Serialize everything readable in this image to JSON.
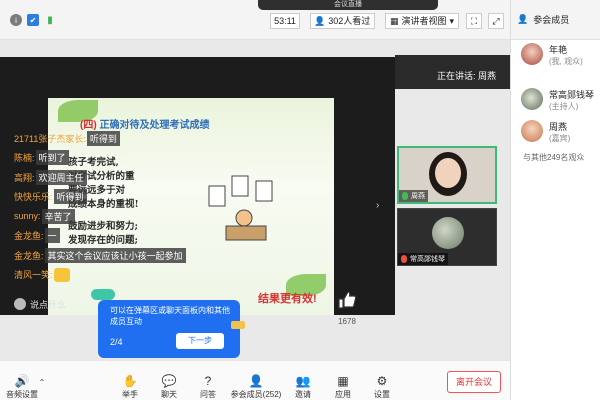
{
  "meeting": {
    "title_partial": "会议直播",
    "timer": "53:11",
    "viewers": "302人看过",
    "view_mode": "演讲者视图"
  },
  "speaking_now": "正在讲话: 周燕",
  "slide": {
    "heading_prefix": "(四)",
    "heading": "正确对待及处理考试成绩",
    "lines": [
      "孩子考完试,",
      "对考试分析的重",
      "要远远多于对",
      "成绩本身的重视!",
      "",
      "鼓励进步和努力;",
      "发现存在的问题;"
    ],
    "banner": "结果更有效!"
  },
  "chat": [
    {
      "name": "21711张子杰家长:",
      "msg": "听得到"
    },
    {
      "name": "陈楠:",
      "msg": "听到了"
    },
    {
      "name": "高翔:",
      "msg": "欢迎周主任"
    },
    {
      "name": "快快乐乐:",
      "msg": "听得到"
    },
    {
      "name": "sunny:",
      "msg": "辛苦了"
    },
    {
      "name": "金龙鱼:",
      "msg": "一"
    },
    {
      "name": "金龙鱼:",
      "msg": "其实这个会议应该让小孩一起参加"
    },
    {
      "name": "清风一笑:",
      "msg": ""
    }
  ],
  "say_placeholder": "说点什么",
  "likes": "1678",
  "tooltip": {
    "text": "可以在弹幕区或聊天面板内和其他成员互动",
    "step": "2/4",
    "next": "下一步"
  },
  "tiles": [
    {
      "name": "周燕"
    },
    {
      "name": "常高郧钱琴"
    }
  ],
  "toolbar": [
    {
      "label": "音频设置",
      "icon": "audio-icon"
    },
    {
      "label": "举手",
      "icon": "hand-icon"
    },
    {
      "label": "聊天",
      "icon": "chat-icon"
    },
    {
      "label": "问答",
      "icon": "qa-icon"
    },
    {
      "label": "参会成员(252)",
      "icon": "members-icon"
    },
    {
      "label": "邀请",
      "icon": "invite-icon"
    },
    {
      "label": "应用",
      "icon": "apps-icon"
    },
    {
      "label": "设置",
      "icon": "settings-icon"
    }
  ],
  "leave": "离开会议",
  "panel": {
    "title": "参会成员",
    "members": [
      {
        "name": "年艳",
        "role": "(我, 观众)"
      },
      {
        "name": "常高郧钱琴",
        "role": "(主持人)"
      },
      {
        "name": "周燕",
        "role": "(嘉宾)"
      }
    ],
    "others": "与其他249名观众"
  },
  "colors": {
    "accent": "#1f6ff0",
    "leave": "#e33333",
    "chat_name": "#f0a23c",
    "active_tile": "#3fb87a"
  }
}
